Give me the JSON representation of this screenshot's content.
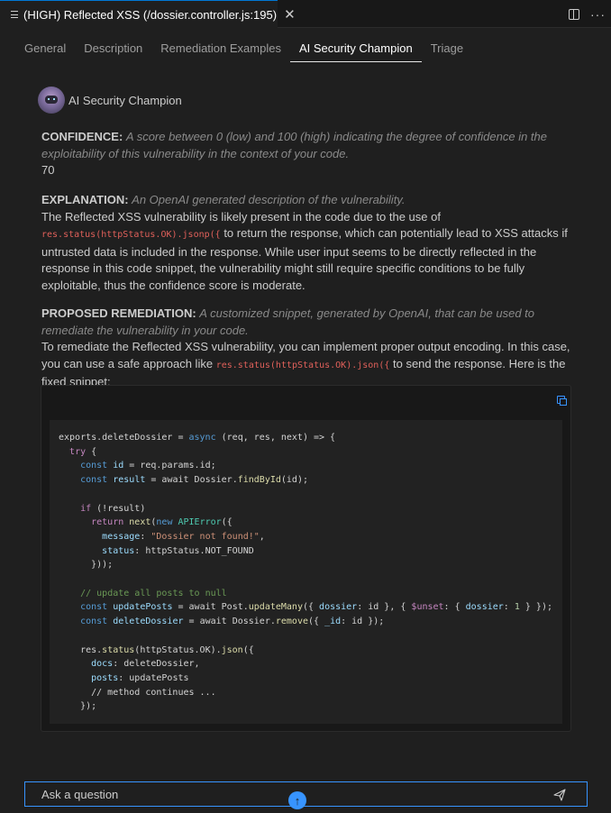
{
  "editor_tab": {
    "title": "(HIGH) Reflected XSS (/dossier.controller.js:195)",
    "close": "✕"
  },
  "tab_actions": {
    "more": "···"
  },
  "nav": {
    "items": [
      "General",
      "Description",
      "Remediation Examples",
      "AI Security Champion",
      "Triage"
    ],
    "active": "AI Security Champion"
  },
  "champion": {
    "name": "AI Security Champion"
  },
  "confidence": {
    "label": "CONFIDENCE:",
    "hint": "A score between 0 (low) and 100 (high) indicating the degree of confidence in the exploitability of this vulnerability in the context of your code.",
    "value": "70"
  },
  "explanation": {
    "label": "EXPLANATION:",
    "hint": "An OpenAI generated description of the vulnerability.",
    "text_before": "The Reflected XSS vulnerability is likely present in the code due to the use of",
    "code": "res.status(httpStatus.OK).jsonp({",
    "text_after": "to return the response, which can potentially lead to XSS attacks if untrusted data is included in the response. While user input seems to be directly reflected in the response in this code snippet, the vulnerability might still require specific conditions to be fully exploitable, thus the confidence score is moderate."
  },
  "remediation": {
    "label": "PROPOSED REMEDIATION:",
    "hint": "A customized snippet, generated by OpenAI, that can be used to remediate the vulnerability in your code.",
    "text_before": "To remediate the Reflected XSS vulnerability, you can implement proper output encoding. In this case, you can use a safe approach like",
    "code": "res.status(httpStatus.OK).json({",
    "text_after": "to send the response. Here is the fixed snippet:"
  },
  "snippet": {
    "lines": [
      [
        [
          "exports.deleteDossier = ",
          ""
        ],
        [
          "async",
          "kw"
        ],
        [
          " (req, res, next) => {",
          ""
        ]
      ],
      [
        [
          "  ",
          ""
        ],
        [
          "try",
          "kw2"
        ],
        [
          " {",
          ""
        ]
      ],
      [
        [
          "    ",
          ""
        ],
        [
          "const",
          "kw"
        ],
        [
          " ",
          ""
        ],
        [
          "id",
          "var"
        ],
        [
          " = req.params.id;",
          ""
        ]
      ],
      [
        [
          "    ",
          ""
        ],
        [
          "const",
          "kw"
        ],
        [
          " ",
          ""
        ],
        [
          "result",
          "var"
        ],
        [
          " = await Dossier.",
          ""
        ],
        [
          "findById",
          "fn"
        ],
        [
          "(id);",
          ""
        ]
      ],
      [
        [
          "",
          ""
        ]
      ],
      [
        [
          "    ",
          ""
        ],
        [
          "if",
          "kw2"
        ],
        [
          " (!result)",
          ""
        ]
      ],
      [
        [
          "      ",
          ""
        ],
        [
          "return",
          "kw2"
        ],
        [
          " ",
          ""
        ],
        [
          "next",
          "fn"
        ],
        [
          "(",
          ""
        ],
        [
          "new",
          "kw"
        ],
        [
          " ",
          ""
        ],
        [
          "APIError",
          "cls"
        ],
        [
          "({",
          ""
        ]
      ],
      [
        [
          "        ",
          ""
        ],
        [
          "message",
          "prop"
        ],
        [
          ": ",
          ""
        ],
        [
          "\"Dossier not found!\"",
          "str"
        ],
        [
          ",",
          ""
        ]
      ],
      [
        [
          "        ",
          ""
        ],
        [
          "status",
          "prop"
        ],
        [
          ": httpStatus.NOT_FOUND",
          ""
        ]
      ],
      [
        [
          "      }));",
          ""
        ]
      ],
      [
        [
          "",
          ""
        ]
      ],
      [
        [
          "    ",
          ""
        ],
        [
          "// update all posts to null",
          "cmt"
        ]
      ],
      [
        [
          "    ",
          ""
        ],
        [
          "const",
          "kw"
        ],
        [
          " ",
          ""
        ],
        [
          "updatePosts",
          "var"
        ],
        [
          " = await Post.",
          ""
        ],
        [
          "updateMany",
          "fn"
        ],
        [
          "({ ",
          ""
        ],
        [
          "dossier",
          "prop"
        ],
        [
          ": id }, { ",
          ""
        ],
        [
          "$unset",
          "kw2"
        ],
        [
          ": { ",
          ""
        ],
        [
          "dossier",
          "prop"
        ],
        [
          ": ",
          ""
        ],
        [
          "1",
          "num"
        ],
        [
          " } });",
          ""
        ]
      ],
      [
        [
          "    ",
          ""
        ],
        [
          "const",
          "kw"
        ],
        [
          " ",
          ""
        ],
        [
          "deleteDossier",
          "var"
        ],
        [
          " = await Dossier.",
          ""
        ],
        [
          "remove",
          "fn"
        ],
        [
          "({ ",
          ""
        ],
        [
          "_id",
          "prop"
        ],
        [
          ": id });",
          ""
        ]
      ],
      [
        [
          "",
          ""
        ]
      ],
      [
        [
          "    res.",
          ""
        ],
        [
          "status",
          "fn"
        ],
        [
          "(httpStatus.OK).",
          ""
        ],
        [
          "json",
          "fn"
        ],
        [
          "({",
          ""
        ]
      ],
      [
        [
          "      ",
          ""
        ],
        [
          "docs",
          "prop"
        ],
        [
          ": deleteDossier,",
          ""
        ]
      ],
      [
        [
          "      ",
          ""
        ],
        [
          "posts",
          "prop"
        ],
        [
          ": updatePosts",
          ""
        ]
      ],
      [
        [
          "      // method continues ...",
          ""
        ]
      ],
      [
        [
          "    });",
          ""
        ]
      ]
    ]
  },
  "ask": {
    "placeholder": "Ask a question"
  },
  "scroll_button": {
    "glyph": "↑"
  },
  "colors": {
    "accent": "#3794ff",
    "inline_code": "#e0605a",
    "background": "#1f1f1f"
  }
}
